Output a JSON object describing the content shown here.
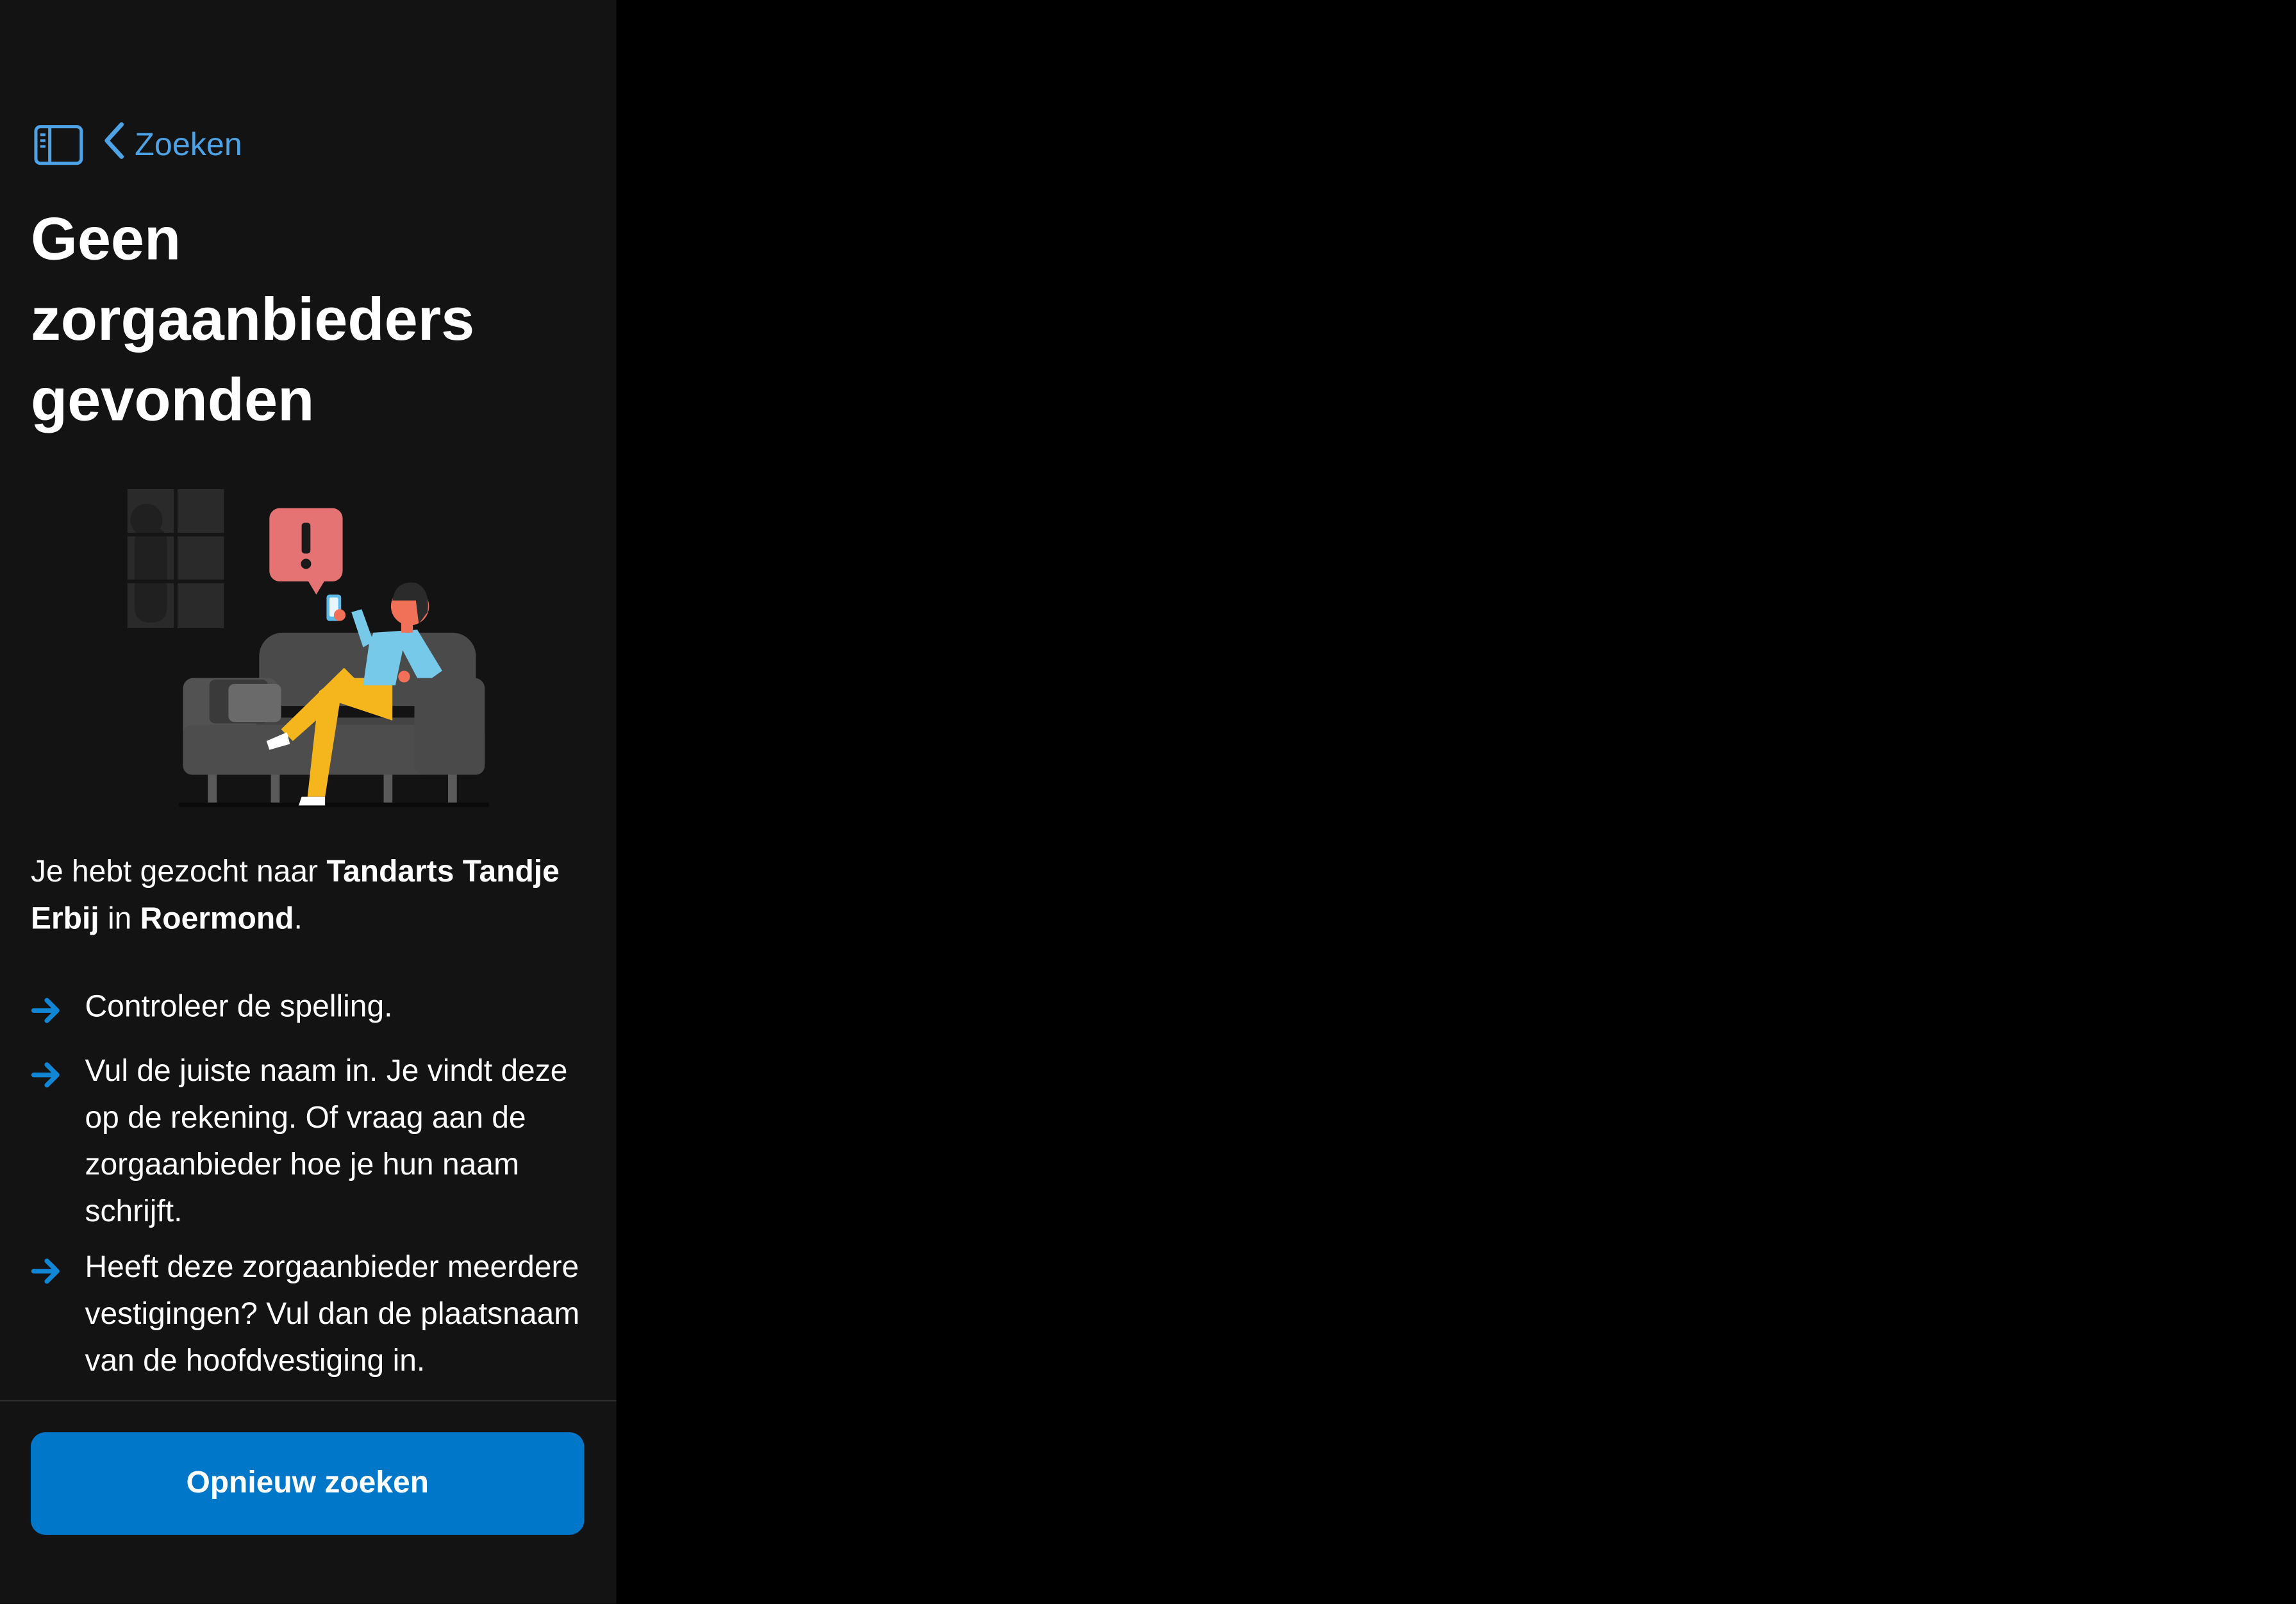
{
  "nav": {
    "back_label": "Zoeken"
  },
  "page": {
    "title": "Geen zorgaanbieders gevonden"
  },
  "summary": {
    "prefix": "Je hebt gezocht naar ",
    "query": "Tandarts Tandje Erbij",
    "middle": " in ",
    "place": "Roermond",
    "suffix": "."
  },
  "tips": [
    "Controleer de spelling.",
    "Vul de juiste naam in. Je vindt deze op de rekening. Of vraag aan de zorgaanbieder hoe je hun naam schrijft.",
    "Heeft deze zorgaanbieder meerdere vestigingen? Vul dan de plaatsnaam van de hoofdvestiging in."
  ],
  "footer": {
    "button_label": "Opnieuw zoeken"
  },
  "icons": {
    "sidebar_toggle": "sidebar-icon",
    "back": "chevron-left-icon",
    "tip_bullet": "arrow-right-icon",
    "alert": "exclamation-icon"
  },
  "colors": {
    "accent": "#0077c8",
    "link": "#4ea3e6",
    "sidebar_bg": "#131313",
    "detail_bg": "#000000",
    "alert_bubble": "#e57373"
  }
}
